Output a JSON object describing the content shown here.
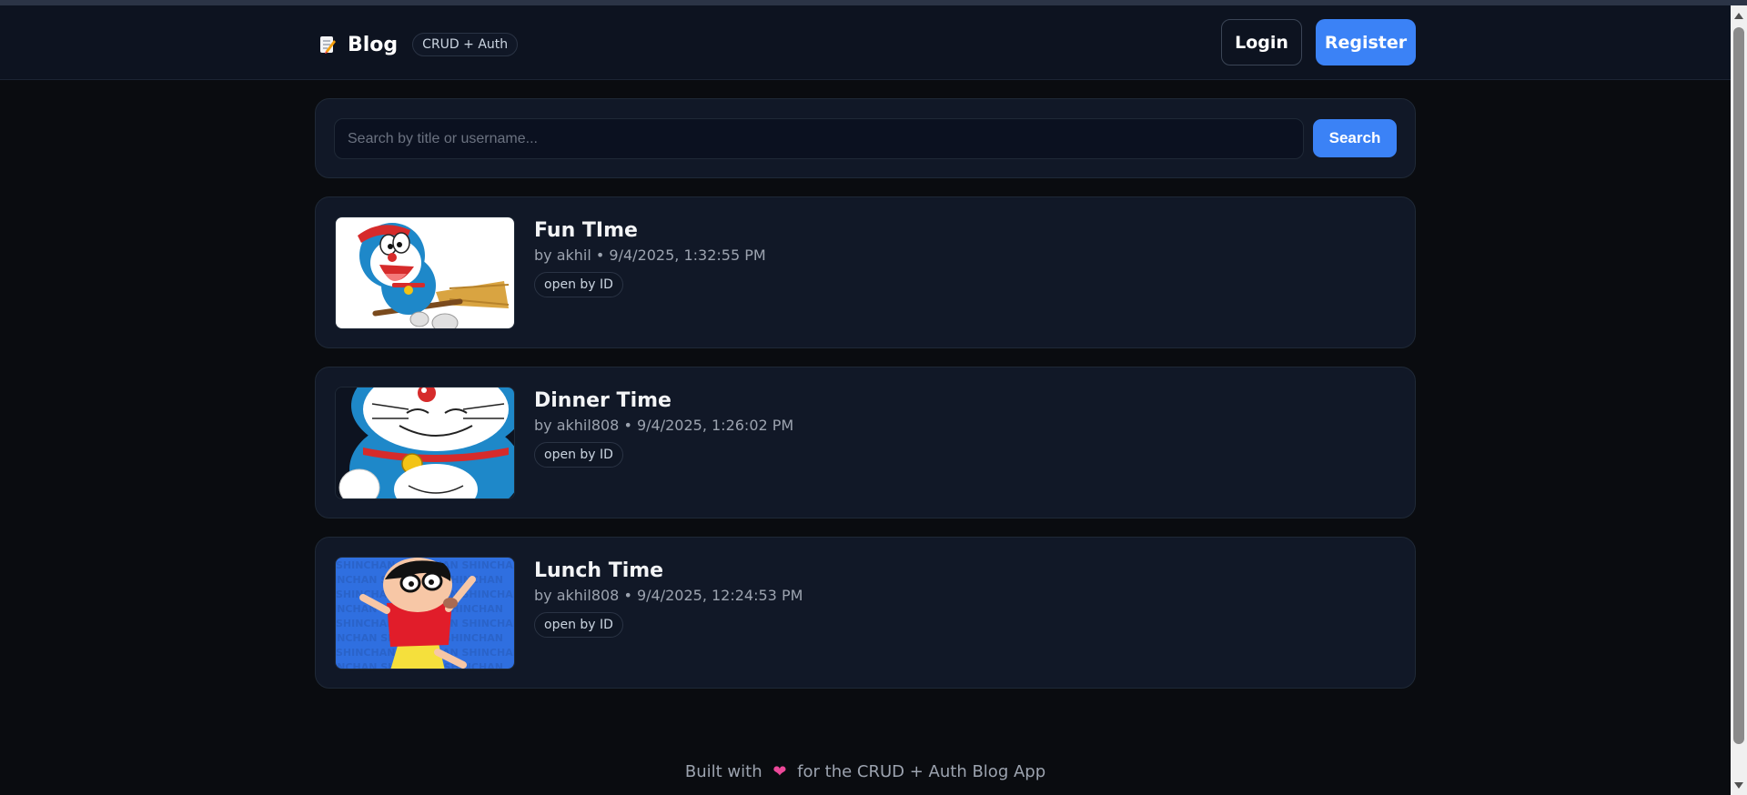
{
  "header": {
    "brand_name": "Blog",
    "brand_icon": "memo-icon",
    "badge": "CRUD + Auth",
    "login_label": "Login",
    "register_label": "Register"
  },
  "search": {
    "placeholder": "Search by title or username...",
    "value": "",
    "button_label": "Search"
  },
  "posts": [
    {
      "title": "Fun TIme",
      "meta": "by akhil • 9/4/2025, 1:32:55 PM",
      "link_label": "open by ID",
      "thumbnail": "doraemon-broom-image"
    },
    {
      "title": "Dinner Time",
      "meta": "by akhil808 • 9/4/2025, 1:26:02 PM",
      "link_label": "open by ID",
      "thumbnail": "doraemon-smiling-image"
    },
    {
      "title": "Lunch Time",
      "meta": "by akhil808 • 9/4/2025, 12:24:53 PM",
      "link_label": "open by ID",
      "thumbnail": "shinchan-image"
    }
  ],
  "footer": {
    "prefix": "Built with",
    "heart": "❤",
    "suffix": "for the CRUD + Auth Blog App"
  },
  "colors": {
    "accent": "#3b82f6",
    "background": "#0a0c10",
    "card": "#111827"
  }
}
